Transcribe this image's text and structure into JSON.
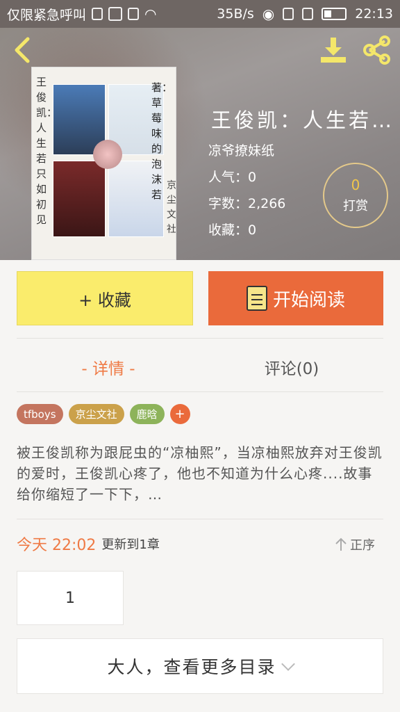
{
  "status_bar": {
    "carrier": "仅限紧急呼叫",
    "speed": "35B/s",
    "time": "22:13"
  },
  "header": {
    "title": "王俊凯：人生若…",
    "author": "凉爷撩妹纸",
    "popularity": "人气：0",
    "word_count": "字数：2,266",
    "favorites": "收藏：0",
    "tip_count": "0",
    "tip_label": "打赏"
  },
  "cover": {
    "left_text": "王俊凯：人生若只如初见",
    "right_text": "著：草莓味的泡沫若",
    "right_text2": "京尘文社"
  },
  "actions": {
    "collect_label": "+ 收藏",
    "read_label": "开始阅读"
  },
  "tabs": [
    {
      "label": "- 详情 -"
    },
    {
      "label": "评论(0)"
    }
  ],
  "tags": [
    {
      "label": "tfboys",
      "color": "#c4755f"
    },
    {
      "label": "京尘文社",
      "color": "#cba14a"
    },
    {
      "label": "鹿晗",
      "color": "#8db35a"
    }
  ],
  "description": "被王俊凯称为跟屁虫的“凉柚熙”，当凉柚熙放弃对王俊凯的爱时，王俊凯心疼了，他也不知道为什么心疼....故事给你缩短了一下下，…",
  "update": {
    "date": "今天 22:02",
    "text": "更新到1章",
    "sort_label": "正序"
  },
  "chapters": [
    {
      "label": "1"
    }
  ],
  "more_label": "大人，查看更多目录",
  "colors": {
    "accent": "#ea6a3b",
    "collect_bg": "#faec6c",
    "tip_border": "#e4c98a"
  }
}
